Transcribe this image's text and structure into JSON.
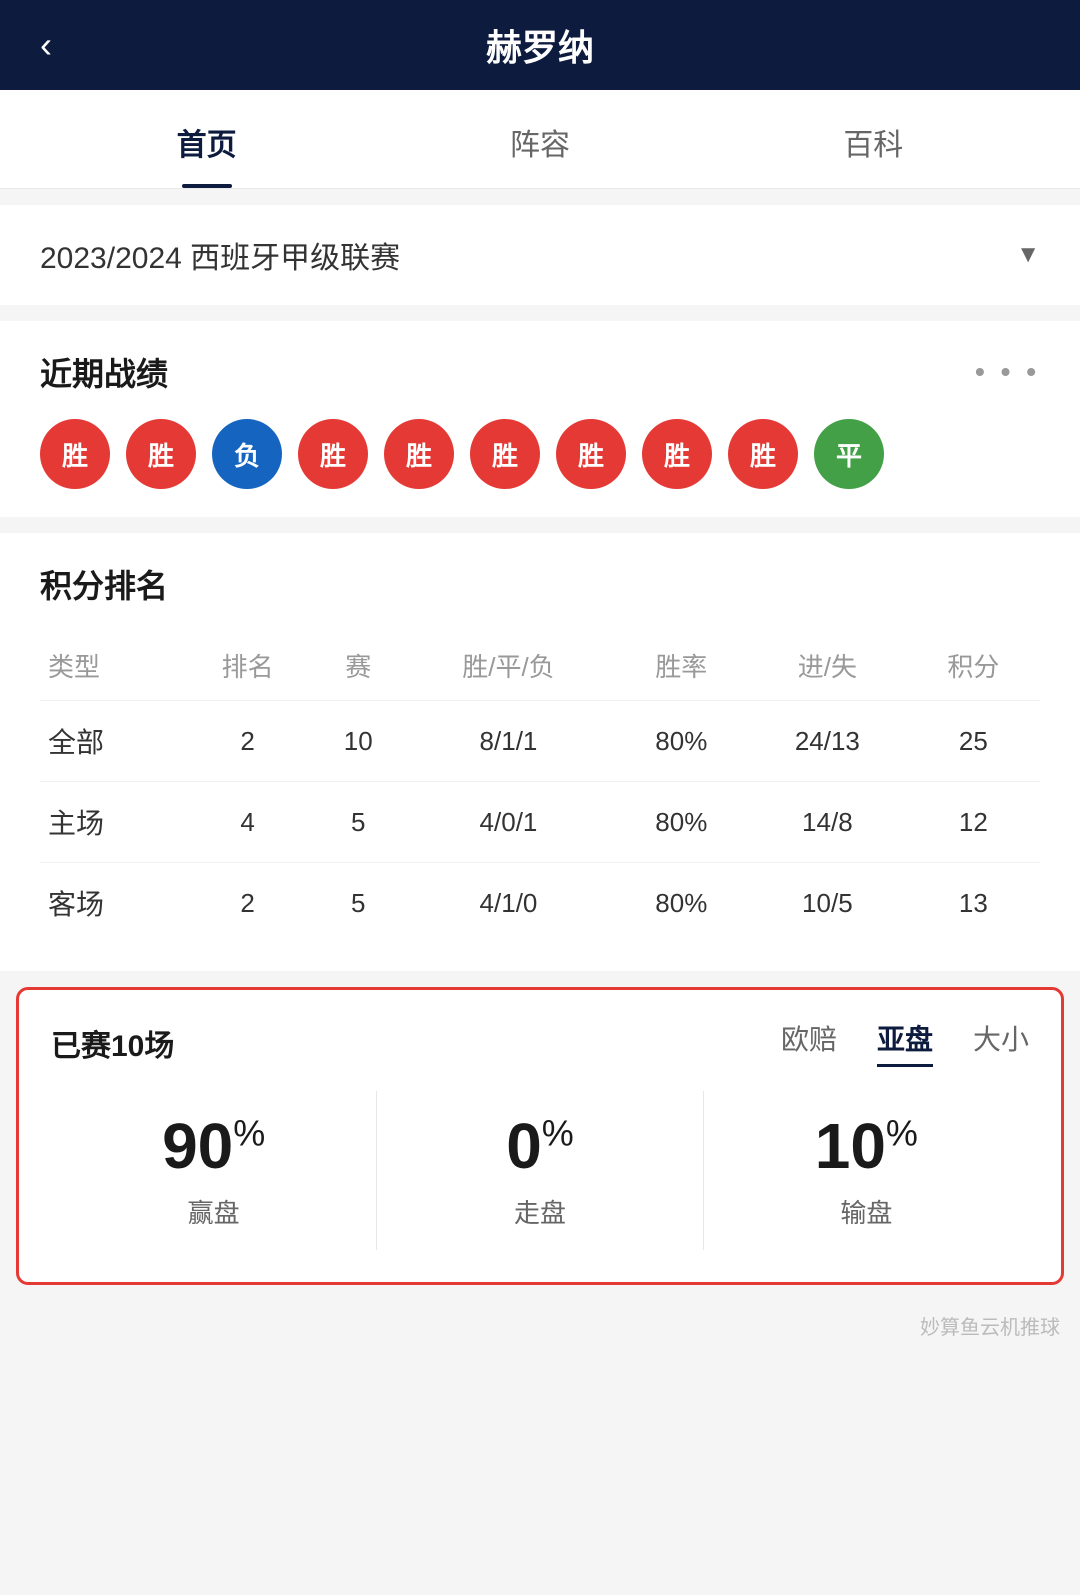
{
  "header": {
    "title": "赫罗纳",
    "back_icon": "‹"
  },
  "tabs": [
    {
      "label": "首页",
      "active": true
    },
    {
      "label": "阵容",
      "active": false
    },
    {
      "label": "百科",
      "active": false
    }
  ],
  "season": {
    "label": "2023/2024 西班牙甲级联赛"
  },
  "recent_results": {
    "title": "近期战绩",
    "results": [
      {
        "text": "胜",
        "type": "win"
      },
      {
        "text": "胜",
        "type": "win"
      },
      {
        "text": "负",
        "type": "loss"
      },
      {
        "text": "胜",
        "type": "win"
      },
      {
        "text": "胜",
        "type": "win"
      },
      {
        "text": "胜",
        "type": "win"
      },
      {
        "text": "胜",
        "type": "win"
      },
      {
        "text": "胜",
        "type": "win"
      },
      {
        "text": "胜",
        "type": "win"
      },
      {
        "text": "平",
        "type": "draw"
      }
    ]
  },
  "standings": {
    "title": "积分排名",
    "columns": [
      "类型",
      "排名",
      "赛",
      "胜/平/负",
      "胜率",
      "进/失",
      "积分"
    ],
    "rows": [
      {
        "type": "全部",
        "rank": "2",
        "matches": "10",
        "wdl": "8/1/1",
        "win_rate": "80%",
        "gd": "24/13",
        "points": "25"
      },
      {
        "type": "主场",
        "rank": "4",
        "matches": "5",
        "wdl": "4/0/1",
        "win_rate": "80%",
        "gd": "14/8",
        "points": "12"
      },
      {
        "type": "客场",
        "rank": "2",
        "matches": "5",
        "wdl": "4/1/0",
        "win_rate": "80%",
        "gd": "10/5",
        "points": "13"
      }
    ]
  },
  "odds": {
    "title": "已赛10场",
    "tabs": [
      {
        "label": "欧赔",
        "active": false
      },
      {
        "label": "亚盘",
        "active": true
      },
      {
        "label": "大小",
        "active": false
      }
    ],
    "cards": [
      {
        "percent": "90",
        "label": "赢盘"
      },
      {
        "percent": "0",
        "label": "走盘"
      },
      {
        "percent": "10",
        "label": "输盘"
      }
    ]
  },
  "watermark": {
    "text": "妙算鱼云机推球"
  }
}
